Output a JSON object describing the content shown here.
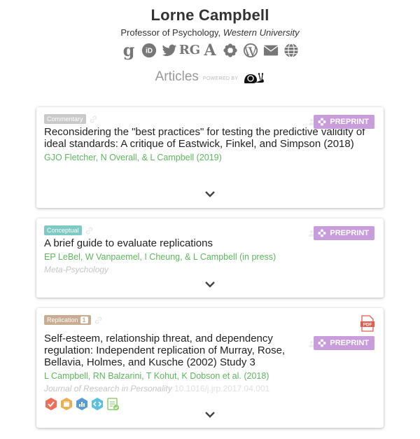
{
  "profile": {
    "name": "Lorne Campbell",
    "position": "Professor of Psychology,",
    "institution": "Western University"
  },
  "social_icons": [
    "google-scholar-icon",
    "orcid-icon",
    "twitter-icon",
    "researchgate-icon",
    "academia-icon",
    "osf-icon",
    "wordpress-icon",
    "email-icon",
    "website-icon"
  ],
  "social_text": {
    "google": "g",
    "orcid": "iD",
    "researchgate": "RG",
    "academia": "A"
  },
  "header": {
    "articles": "Articles",
    "powered_by": "POWERED BY"
  },
  "articles": [
    {
      "type": "Commentary",
      "type_color": "#c9c9c9",
      "title": "Reconsidering the \"best practices\" for testing the predictive validity of ideal standards: A critique of Eastwick, Finkel, and Simpson (2018)",
      "authors": "GJO Fletcher, N Overall, & L Campbell (2019)",
      "preprint_label": "PREPRINT"
    },
    {
      "type": "Conceptual",
      "type_color": "#7dc9c4",
      "title": "A brief guide to evaluate replications",
      "authors": "EP LeBel, W Vanpaemel, I Cheung, & L Campbell (in press)",
      "journal": "Meta-Psychology",
      "preprint_label": "PREPRINT"
    },
    {
      "type": "Replication",
      "type_count": "1",
      "type_color": "#c9ad93",
      "title": "Self-esteem, relationship threat, and dependency regulation: Independent replication of Murray, Rose, Bellavia, Holmes, and Kusche (2002) Study 3",
      "authors": "L Campbell, RN Balzarini, T Kohut, K Dobson et al. (2018)",
      "journal": "Journal of Research in Personality",
      "doi": "10.1016/j.jrp.2017.04.001",
      "preprint_label": "PREPRINT",
      "pdf_label": "PDF",
      "badges": [
        "prereg-badge",
        "materials-badge",
        "data-badge",
        "code-badge",
        "checklist-badge"
      ]
    }
  ],
  "colors": {
    "author_green": "#5cb85c",
    "preprint_purple": "#c99cdc",
    "badge_red": "#ee6e57",
    "badge_orange": "#f0ad4e",
    "badge_blue": "#5b9bd5",
    "badge_teal": "#5bc0de",
    "badge_green": "#8fd16f"
  }
}
